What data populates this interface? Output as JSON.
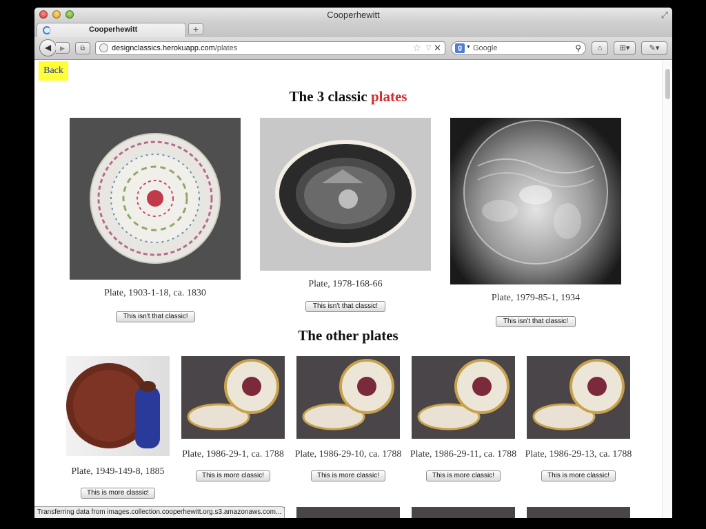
{
  "window": {
    "title": "Cooperhewitt"
  },
  "tab": {
    "label": "Cooperhewitt"
  },
  "navbar": {
    "url_host": "designclassics.herokuapp.com",
    "url_path": "/plates",
    "search_placeholder": "Google"
  },
  "page": {
    "back_label": "Back",
    "heading_prefix": "The 3 classic ",
    "heading_accent": "plates",
    "heading_accent_color": "#d92a2a",
    "other_heading": "The other plates"
  },
  "classic_plates": [
    {
      "caption": "Plate, 1903-1-18, ca. 1830",
      "button": "This isn't that classic!"
    },
    {
      "caption": "Plate, 1978-168-66",
      "button": "This isn't that classic!"
    },
    {
      "caption": "Plate, 1979-85-1, 1934",
      "button": "This isn't that classic!"
    }
  ],
  "other_plates": [
    {
      "caption": "Plate, 1949-149-8, 1885",
      "button": "This is more classic!"
    },
    {
      "caption": "Plate, 1986-29-1, ca. 1788",
      "button": "This is more classic!"
    },
    {
      "caption": "Plate, 1986-29-10, ca. 1788",
      "button": "This is more classic!"
    },
    {
      "caption": "Plate, 1986-29-11, ca. 1788",
      "button": "This is more classic!"
    },
    {
      "caption": "Plate, 1986-29-13, ca. 1788",
      "button": "This is more classic!"
    }
  ],
  "status": {
    "text": "Transferring data from images.collection.cooperhewitt.org.s3.amazonaws.com..."
  },
  "icons": {
    "back": "back-arrow-icon",
    "forward": "forward-arrow-icon",
    "bookmark": "star-icon",
    "stop": "stop-icon",
    "search": "magnifier-icon",
    "home": "home-icon",
    "addons": "addons-icon",
    "tools": "tools-icon",
    "new_tab": "plus-icon"
  }
}
